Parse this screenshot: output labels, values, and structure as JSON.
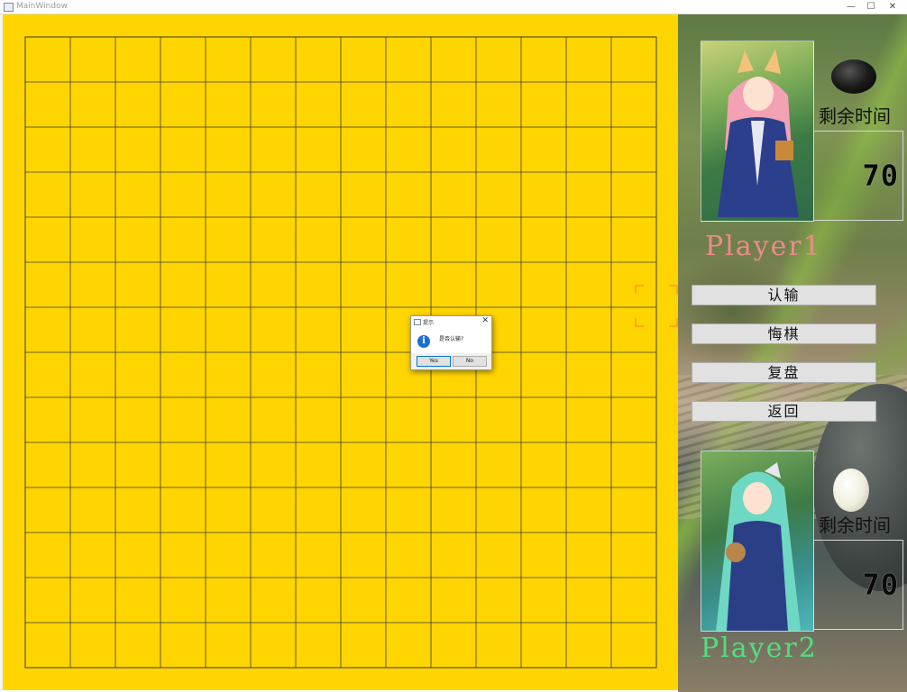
{
  "window": {
    "title": "MainWindow",
    "minimize_glyph": "—",
    "maximize_glyph": "☐",
    "close_glyph": "✕"
  },
  "board": {
    "background_color": "#ffd500",
    "line_color": "#3a3a3a",
    "columns": 14,
    "rows": 14
  },
  "sidebar": {
    "player1": {
      "name": "Player1",
      "name_color": "#ef8a8a",
      "stone": "black",
      "remaining_label": "剩余时间",
      "timer_value": "70"
    },
    "player2": {
      "name": "Player2",
      "name_color": "#4fe07e",
      "stone": "white",
      "remaining_label": "剩余时间",
      "timer_value": "70"
    },
    "buttons": {
      "resign": "认输",
      "undo": "悔棋",
      "replay": "复盘",
      "back": "返回"
    }
  },
  "dialog": {
    "title": "提示",
    "message": "是否认输?",
    "icon": "info-icon",
    "yes_label": "Yes",
    "no_label": "No",
    "close_glyph": "✕"
  },
  "cursor_marker_color": "#ff8c1a"
}
